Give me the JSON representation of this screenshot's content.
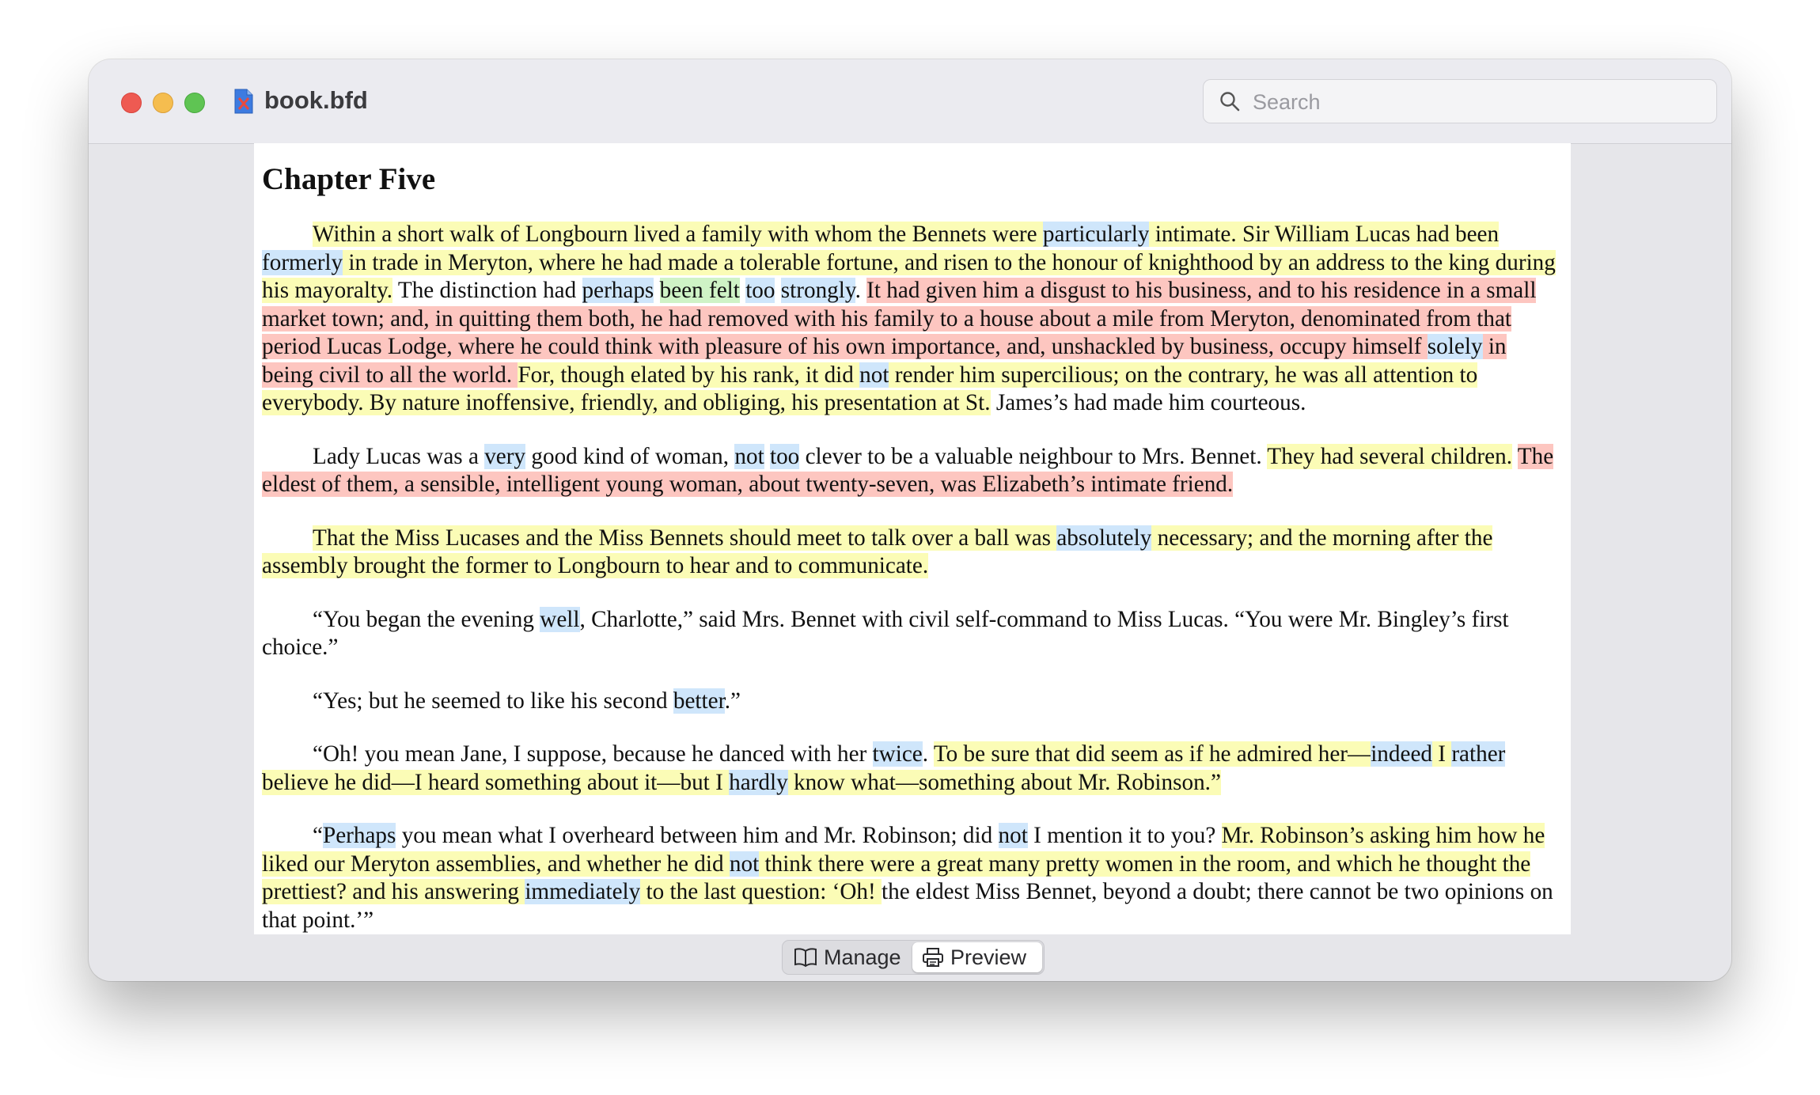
{
  "window": {
    "title": "book.bfd",
    "search_placeholder": "Search"
  },
  "document": {
    "chapter_title": "Chapter Five",
    "highlight_colors": {
      "yellow": "#fbfcb6",
      "red": "#fdc6c0",
      "blue": "#cfe6fb",
      "green": "#cff3c6"
    },
    "paragraphs": [
      [
        {
          "t": "Within a short walk of Longbourn lived a family with whom the Bennets were ",
          "h": "y"
        },
        {
          "t": "particularly",
          "h": "b"
        },
        {
          "t": " intimate. Sir William Lucas had been ",
          "h": "y"
        },
        {
          "t": "formerly",
          "h": "b"
        },
        {
          "t": " in trade in Meryton, where he had made a tolerable fortune, and risen to the honour of knighthood by an address to the king during his mayoralty.",
          "h": "y"
        },
        {
          "t": " The distinction had ",
          "h": ""
        },
        {
          "t": "perhaps",
          "h": "b"
        },
        {
          "t": " ",
          "h": ""
        },
        {
          "t": "been felt",
          "h": "g"
        },
        {
          "t": " ",
          "h": ""
        },
        {
          "t": "too",
          "h": "b"
        },
        {
          "t": " ",
          "h": ""
        },
        {
          "t": "strongly",
          "h": "b"
        },
        {
          "t": ". ",
          "h": ""
        },
        {
          "t": "It had given him a disgust to his business, and to his residence in a small market town; and, in quitting them both, he had removed with his family to a house about a mile from Meryton, denominated from that period Lucas Lodge, where he could think with pleasure of his own importance, and, unshackled by business, occupy himself ",
          "h": "r"
        },
        {
          "t": "solely",
          "h": "b"
        },
        {
          "t": " in being civil to all the world. ",
          "h": "r"
        },
        {
          "t": "For, though elated by his rank, it did ",
          "h": "y"
        },
        {
          "t": "not",
          "h": "b"
        },
        {
          "t": " render him supercilious; on the contrary, he was all attention to everybody. By nature inoffensive, friendly, and obliging, his presentation at St.",
          "h": "y"
        },
        {
          "t": " James’s had made him courteous.",
          "h": ""
        }
      ],
      [
        {
          "t": "Lady Lucas was a ",
          "h": ""
        },
        {
          "t": "very",
          "h": "b"
        },
        {
          "t": " good kind of woman, ",
          "h": ""
        },
        {
          "t": "not",
          "h": "b"
        },
        {
          "t": " ",
          "h": ""
        },
        {
          "t": "too",
          "h": "b"
        },
        {
          "t": " clever to be a valuable neighbour to Mrs. Bennet. ",
          "h": ""
        },
        {
          "t": "They had several children.",
          "h": "y"
        },
        {
          "t": " ",
          "h": ""
        },
        {
          "t": "The eldest of them, a sensible, intelligent young woman, about twenty-seven, was Elizabeth’s intimate friend.",
          "h": "r"
        }
      ],
      [
        {
          "t": "That the Miss Lucases and the Miss Bennets should meet to talk over a ball was ",
          "h": "y"
        },
        {
          "t": "absolutely",
          "h": "b"
        },
        {
          "t": " necessary; and the morning after the assembly brought the former to Longbourn to hear and to communicate.",
          "h": "y"
        }
      ],
      [
        {
          "t": "“You began the evening ",
          "h": ""
        },
        {
          "t": "well",
          "h": "b"
        },
        {
          "t": ", Charlotte,” said Mrs. Bennet with civil self-command to Miss Lucas. “You were Mr. Bingley’s first choice.”",
          "h": ""
        }
      ],
      [
        {
          "t": "“Yes; but he seemed to like his second ",
          "h": ""
        },
        {
          "t": "better",
          "h": "b"
        },
        {
          "t": ".”",
          "h": ""
        }
      ],
      [
        {
          "t": "“Oh! you mean Jane, I suppose, because he danced with her ",
          "h": ""
        },
        {
          "t": "twice",
          "h": "b"
        },
        {
          "t": ". ",
          "h": ""
        },
        {
          "t": "To be sure that did seem as if he admired her—",
          "h": "y"
        },
        {
          "t": "indeed",
          "h": "b"
        },
        {
          "t": " I ",
          "h": "y"
        },
        {
          "t": "rather",
          "h": "b"
        },
        {
          "t": " believe he did—I heard something about it—but I ",
          "h": "y"
        },
        {
          "t": "hardly",
          "h": "b"
        },
        {
          "t": " know what—something about Mr. Robinson.”",
          "h": "y"
        }
      ],
      [
        {
          "t": "“",
          "h": ""
        },
        {
          "t": "Perhaps",
          "h": "b"
        },
        {
          "t": " you mean what I overheard between him and Mr. Robinson; did ",
          "h": ""
        },
        {
          "t": "not",
          "h": "b"
        },
        {
          "t": " I mention it to you? ",
          "h": ""
        },
        {
          "t": "Mr. Robinson’s asking him how he liked our Meryton assemblies, and whether he did ",
          "h": "y"
        },
        {
          "t": "not",
          "h": "b"
        },
        {
          "t": " think there were a great many pretty women in the room, and which he thought the prettiest? and his answering ",
          "h": "y"
        },
        {
          "t": "immediately",
          "h": "b"
        },
        {
          "t": " to the last question: ‘Oh! ",
          "h": "y"
        },
        {
          "t": "the eldest Miss Bennet, beyond a doubt; there cannot be two opinions on that point.’”",
          "h": ""
        }
      ]
    ]
  },
  "toolbar": {
    "manage_label": "Manage",
    "preview_label": "Preview"
  }
}
